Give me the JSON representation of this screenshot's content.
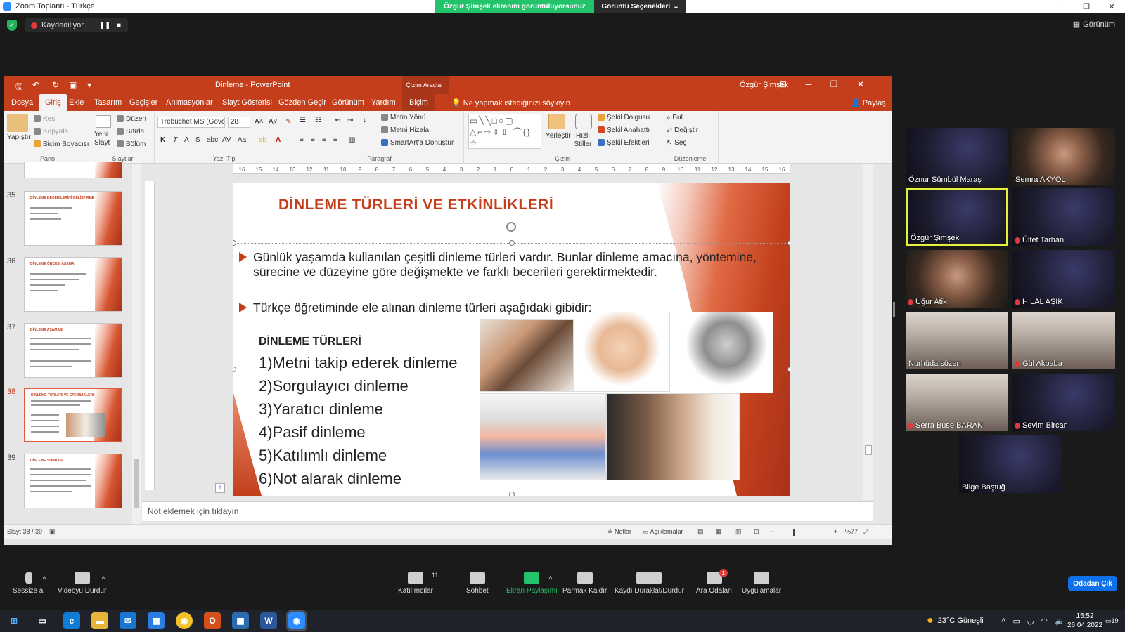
{
  "zoom": {
    "window_title": "Zoom Toplantı - Türkçe",
    "share_banner": "Özgür Şimşek ekranını görüntülüyorsunuz",
    "view_options": "Görüntü Seçenekleri",
    "recording": "Kaydediliyor...",
    "view_label": "Görünüm",
    "participants_count": "11",
    "toolbar": [
      {
        "label": "Sessize al",
        "icon": "mic-icon"
      },
      {
        "label": "Videoyu Durdur",
        "icon": "video-icon"
      },
      {
        "label": "Katılımcılar",
        "icon": "participants-icon"
      },
      {
        "label": "Sohbet",
        "icon": "chat-icon"
      },
      {
        "label": "Ekran Paylaşımı",
        "icon": "share-screen-icon"
      },
      {
        "label": "Parmak Kaldır",
        "icon": "raise-hand-icon"
      },
      {
        "label": "Kaydı Duraklat/Durdur",
        "icon": "pause-record-icon"
      },
      {
        "label": "Ara Odaları",
        "icon": "breakout-rooms-icon"
      },
      {
        "label": "Uygulamalar",
        "icon": "apps-icon"
      }
    ],
    "end_button": "Odadan Çık",
    "breakout_badge": "1"
  },
  "ppt": {
    "doc_title": "Dinleme  -  PowerPoint",
    "context_tab": "Çizim Araçları",
    "user": "Özgür Şimşek",
    "tabs": [
      "Dosya",
      "Giriş",
      "Ekle",
      "Tasarım",
      "Geçişler",
      "Animasyonlar",
      "Slayt Gösterisi",
      "Gözden Geçir",
      "Görünüm",
      "Yardım",
      "Biçim"
    ],
    "tell_me": "Ne yapmak istediğinizi söyleyin",
    "share": "Paylaş",
    "ribbon": {
      "paste": "Yapıştır",
      "cut": "Kes",
      "copy": "Kopyala",
      "format_painter": "Biçim Boyacısı",
      "clipboard_group": "Pano",
      "new_slide": "Yeni Slayt",
      "layout": "Düzen",
      "reset": "Sıfırla",
      "section": "Bölüm",
      "slides_group": "Slaytlar",
      "font_name": "Trebuchet MS (Gövc",
      "font_size": "28",
      "font_group": "Yazı Tipi",
      "text_direction": "Metin Yönü",
      "align_text": "Metni Hizala",
      "smartart": "SmartArt'a Dönüştür",
      "paragraph_group": "Paragraf",
      "arrange": "Yerleştir",
      "quick_styles": "Hızlı Stiller",
      "shape_fill": "Şekil Dolgusu",
      "shape_outline": "Şekil Anahattı",
      "shape_effects": "Şekil Efektleri",
      "drawing_group": "Çizim",
      "find": "Bul",
      "replace": "Değiştir",
      "select": "Seç",
      "editing_group": "Düzenleme"
    },
    "thumbnails": [
      {
        "num": "35",
        "title": "DİNLEME BECERİLERİNİ GELİŞTİRME"
      },
      {
        "num": "36",
        "title": "DİNLEME ÖNCESİ AŞAMA"
      },
      {
        "num": "37",
        "title": "DİNLEME AŞAMASI"
      },
      {
        "num": "38",
        "title": "DİNLEME TÜRLERİ VE ETKİNLİKLERİ"
      },
      {
        "num": "39",
        "title": "DİNLEME SONRASI"
      }
    ],
    "ruler_ticks": [
      "16",
      "15",
      "14",
      "13",
      "12",
      "11",
      "10",
      "9",
      "8",
      "7",
      "6",
      "5",
      "4",
      "3",
      "2",
      "1",
      "0",
      "1",
      "2",
      "3",
      "4",
      "5",
      "6",
      "7",
      "8",
      "9",
      "10",
      "11",
      "12",
      "13",
      "14",
      "15",
      "16"
    ],
    "slide": {
      "title": "DİNLEME TÜRLERİ VE ETKİNLİKLERİ",
      "bullet1": "Günlük yaşamda kullanılan çeşitli dinleme türleri vardır. Bunlar dinleme amacına, yöntemine, sürecine ve düzeyine göre değişmekte ve farklı becerileri gerektirmektedir.",
      "bullet2": "Türkçe öğretiminde ele alınan dinleme türleri aşağıdaki gibidir:",
      "list_header": "DİNLEME TÜRLERİ",
      "list": [
        "1)Metni takip ederek dinleme",
        "2)Sorgulayıcı dinleme",
        "3)Yaratıcı dinleme",
        "4)Pasif dinleme",
        "5)Katılımlı dinleme",
        "6)Not alarak dinleme"
      ]
    },
    "notes_placeholder": "Not eklemek için tıklayın",
    "status": {
      "slide_count": "Slayt 38 / 39",
      "notes": "Notlar",
      "comments": "Açıklamalar",
      "zoom": "%77"
    }
  },
  "participants": [
    {
      "name": "Öznur Sümbül Maraş",
      "muted": false
    },
    {
      "name": "Semra AKYOL",
      "muted": false
    },
    {
      "name": "Özgür Şimşek",
      "muted": false
    },
    {
      "name": "Ülfet Tarhan",
      "muted": true
    },
    {
      "name": "Uğur Atik",
      "muted": true
    },
    {
      "name": "HİLAL AŞIK",
      "muted": true
    },
    {
      "name": "Nurhüda sözen",
      "muted": false
    },
    {
      "name": "Gül Akbaba",
      "muted": true
    },
    {
      "name": "Serra Buse BARAN",
      "muted": true
    },
    {
      "name": "Sevim Bircan",
      "muted": true
    },
    {
      "name": "Bilge Baştuğ",
      "muted": false
    }
  ],
  "taskbar": {
    "weather": "23°C  Güneşli",
    "time": "15:52",
    "date": "26.04.2022",
    "notif": "19"
  }
}
